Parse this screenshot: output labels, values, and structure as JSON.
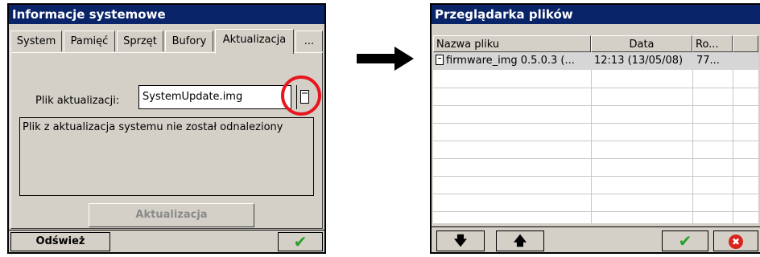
{
  "left_window": {
    "title": "Informacje systemowe",
    "tabs": [
      {
        "label": "System",
        "active": false
      },
      {
        "label": "Pamięć",
        "active": false
      },
      {
        "label": "Sprzęt",
        "active": false
      },
      {
        "label": "Bufory",
        "active": false
      },
      {
        "label": "Aktualizacja",
        "active": true
      },
      {
        "label": "...",
        "active": false
      }
    ],
    "update_file_label": "Plik aktualizacji:",
    "update_file_value": "SystemUpdate.img",
    "message": "Plik z aktualizacja systemu nie został odnaleziony",
    "update_button": "Aktualizacja",
    "refresh_button": "Odśwież",
    "highlight_color": "#e8171f"
  },
  "right_window": {
    "title": "Przeglądarka plików",
    "columns": [
      "Nazwa pliku",
      "Data",
      "Ro..."
    ],
    "rows": [
      {
        "name": "firmware_img 0.5.0.3 (...",
        "date": "12:13 (13/05/08)",
        "size": "77..."
      }
    ],
    "buttons": {
      "down": "down-arrow-icon",
      "up": "up-arrow-icon",
      "ok": "checkmark-icon",
      "cancel": "cancel-icon"
    }
  },
  "colors": {
    "titlebar": "#0a246a",
    "window_bg": "#d4d0c8",
    "ok_green": "#2aa02a",
    "cancel_red": "#d9241c"
  }
}
